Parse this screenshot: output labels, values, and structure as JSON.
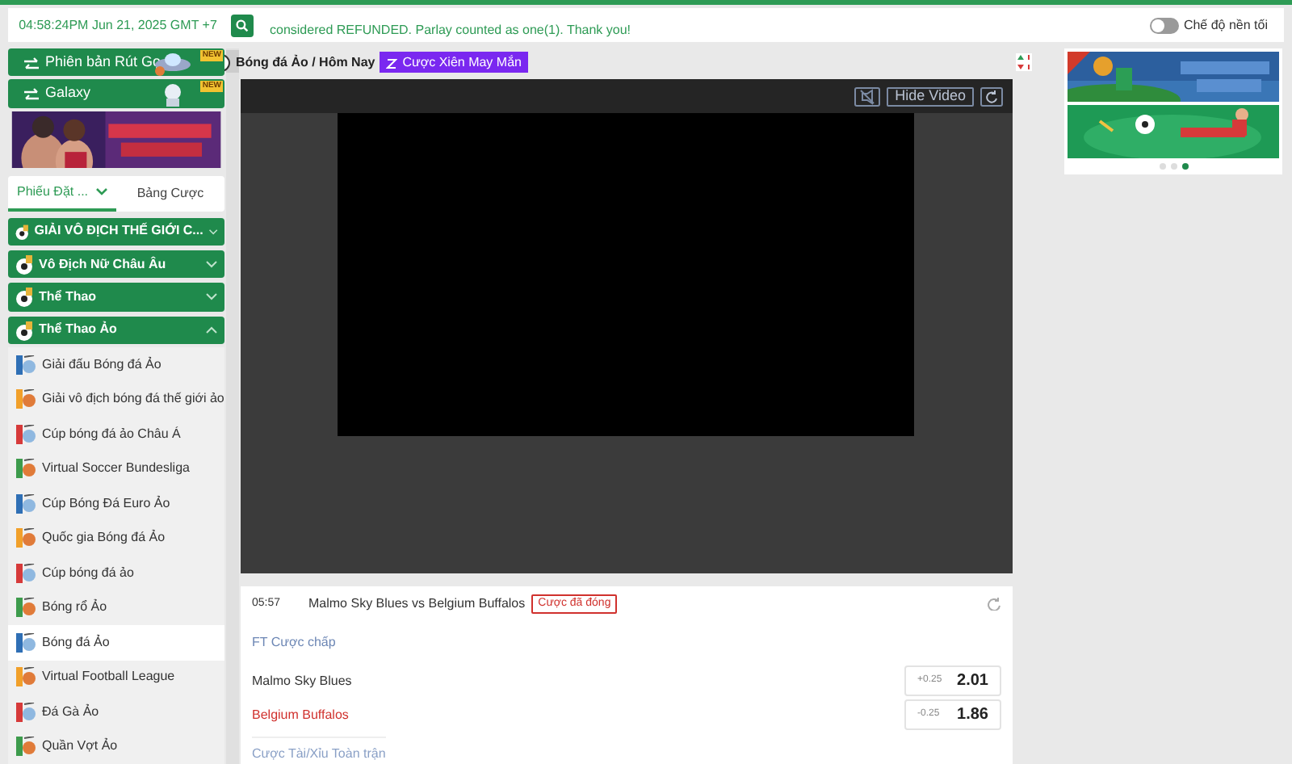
{
  "header": {
    "clock": "04:58:24PM Jun 21, 2025 GMT +7",
    "ticker": "considered REFUNDED. Parlay counted as one(1). Thank you!",
    "dark_mode": {
      "label": "Chế độ nền tối",
      "on": false
    }
  },
  "sidebar": {
    "promos": [
      {
        "label": "Phiên bản Rút Gọ",
        "badge": "NEW"
      },
      {
        "label": "Galaxy",
        "badge": "NEW"
      }
    ],
    "tabs": [
      {
        "label": "Phiếu Đặt ...",
        "selected": true
      },
      {
        "label": "Bảng Cược",
        "selected": false
      }
    ],
    "categories": [
      {
        "label": "GIẢI VÔ ĐỊCH THẾ GIỚI C...",
        "expanded": false
      },
      {
        "label": "Vô Địch Nữ Châu Âu",
        "expanded": false
      },
      {
        "label": "Thể Thao",
        "expanded": false
      },
      {
        "label": "Thể Thao Ảo",
        "expanded": true,
        "children": [
          {
            "label": "Giải đấu Bóng đá Ảo",
            "selected": false
          },
          {
            "label": "Giải vô địch bóng đá thế giới ảo",
            "selected": false
          },
          {
            "label": "Cúp bóng đá ảo Châu Á",
            "selected": false
          },
          {
            "label": "Virtual Soccer Bundesliga",
            "selected": false
          },
          {
            "label": "Cúp Bóng Đá Euro Ảo",
            "selected": false
          },
          {
            "label": "Quốc gia Bóng đá Ảo",
            "selected": false
          },
          {
            "label": "Cúp bóng đá ảo",
            "selected": false
          },
          {
            "label": "Bóng rổ Ảo",
            "selected": false
          },
          {
            "label": "Bóng đá Ảo",
            "selected": true
          },
          {
            "label": "Virtual Football League",
            "selected": false
          },
          {
            "label": "Đá Gà Ảo",
            "selected": false
          },
          {
            "label": "Quần Vợt Ảo",
            "selected": false
          }
        ]
      }
    ]
  },
  "main": {
    "breadcrumb": "Bóng đá Ảo / Hôm Nay",
    "parlay_button": "Cược Xiên May Mắn",
    "video": {
      "hide_button": "Hide Video"
    },
    "match": {
      "time": "05:57",
      "title": "Malmo Sky Blues vs Belgium Buffalos",
      "status": "Cược đã đóng",
      "market": "FT Cược chấp",
      "rows": [
        {
          "team": "Malmo Sky Blues",
          "color": "#333333",
          "handicap": "+0.25",
          "odds": "2.01"
        },
        {
          "team": "Belgium Buffalos",
          "color": "#d0312d",
          "handicap": "-0.25",
          "odds": "1.86"
        }
      ],
      "next_market": "Cược Tài/Xỉu Toàn trận"
    }
  }
}
